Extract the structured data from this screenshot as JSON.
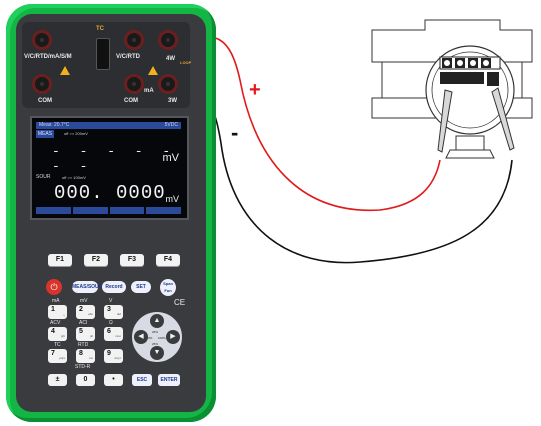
{
  "jacks": {
    "vcrtd": "V/C/RTD/mA/S/M",
    "tc": "TC",
    "vcrtd2": "V/C/RTD",
    "fourw": "4W",
    "com1": "COM",
    "com2": "COM",
    "ma": "mA",
    "threew": "3W",
    "loop": "LOOP"
  },
  "screen": {
    "top_left": "Meas: 20.7°C",
    "top_right": "5VDC",
    "meas_tag": "MEAS",
    "meas_sub": "off  >>  200mV",
    "dashes": "- - - - - - -",
    "unit1": "mV",
    "sour_tag": "SOUR",
    "sour_sub": "off  >>  100mV",
    "value": "000. 0000",
    "unit2": "mV"
  },
  "fkeys": [
    "F1",
    "F2",
    "F3",
    "F4"
  ],
  "func_keys": {
    "power": "⏻",
    "meas_sour": "MEAS/SOUR",
    "record": "Record",
    "set": "SET",
    "span_fun": "Span Fun"
  },
  "key_labels": {
    "ma": "mA",
    "mv": "mV",
    "v": "V",
    "ce": "CE",
    "acv": "ACV",
    "acl": "ACl",
    "ohm": "Ω",
    "tc": "TC",
    "rtd": "RTD",
    "stdr": "STD-R"
  },
  "numkeys": [
    {
      "n": "1",
      "s": "␣"
    },
    {
      "n": "2",
      "s": "abc"
    },
    {
      "n": "3",
      "s": "def"
    },
    {
      "n": "4",
      "s": "ghi"
    },
    {
      "n": "5",
      "s": "jkl"
    },
    {
      "n": "6",
      "s": "mno"
    },
    {
      "n": "7",
      "s": "pqrs"
    },
    {
      "n": "8",
      "s": "tuv"
    },
    {
      "n": "9",
      "s": "wxyz"
    }
  ],
  "bottom_keys": {
    "plusminus": "±",
    "zero": "0",
    "dot": "•",
    "esc": "ESC",
    "enter": "ENTER"
  },
  "dpad": {
    "up": "▲",
    "down": "▼",
    "left": "◀",
    "right": "▶",
    "pct25": "25%",
    "pct0": "0%",
    "pct100": "100%",
    "pct_low": "25%"
  },
  "signs": {
    "plus": "+",
    "minus": "-"
  },
  "colors": {
    "body": "#13b545",
    "red_wire": "#e01b1b",
    "black_wire": "#111111",
    "screen_accent": "#2b4a9a"
  }
}
